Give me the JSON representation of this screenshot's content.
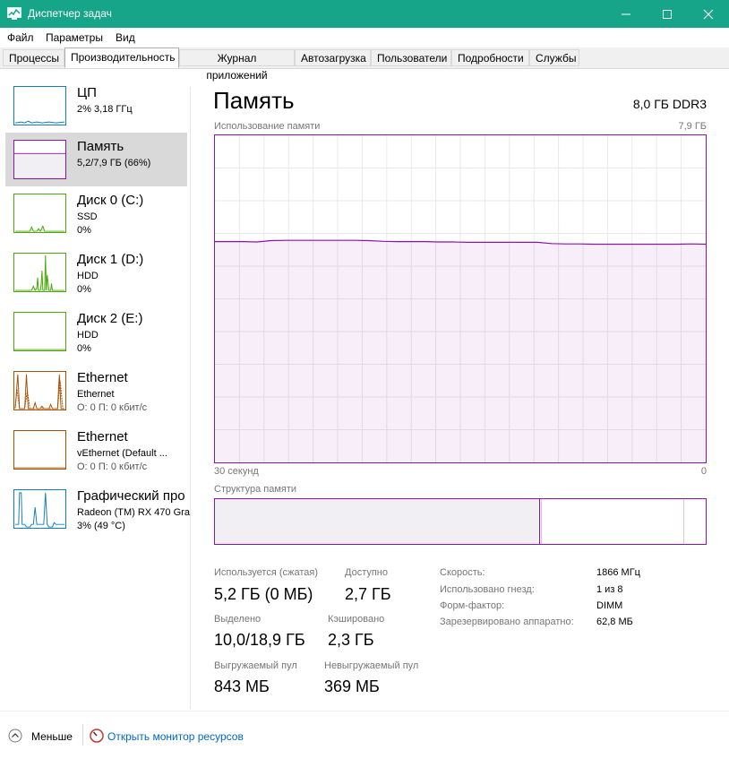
{
  "window": {
    "title": "Диспетчер задач",
    "accent": "#17a589"
  },
  "menu": [
    "Файл",
    "Параметры",
    "Вид"
  ],
  "tabs": [
    "Процессы",
    "Производительность",
    "Журнал приложений",
    "Автозагрузка",
    "Пользователи",
    "Подробности",
    "Службы"
  ],
  "active_tab": "Производительность",
  "sidebar": {
    "items": [
      {
        "name": "ЦП",
        "line1": "2% 3,18 ГГц",
        "line2": "",
        "color": "#117dbb"
      },
      {
        "name": "Память",
        "line1": "5,2/7,9 ГБ (66%)",
        "line2": "",
        "color": "#8b12ae"
      },
      {
        "name": "Диск 0 (C:)",
        "line1": "SSD",
        "line2": "0%",
        "color": "#4da60c"
      },
      {
        "name": "Диск 1 (D:)",
        "line1": "HDD",
        "line2": "0%",
        "color": "#4da60c"
      },
      {
        "name": "Диск 2 (E:)",
        "line1": "HDD",
        "line2": "0%",
        "color": "#4da60c"
      },
      {
        "name": "Ethernet",
        "line1": "Ethernet",
        "line2": "О: 0 П: 0 кбит/с",
        "color": "#a74f01"
      },
      {
        "name": "Ethernet",
        "line1": "vEthernet (Default ...",
        "line2": "О: 0 П: 0 кбит/с",
        "color": "#a74f01"
      },
      {
        "name": "Графический про",
        "line1": "Radeon (TM) RX 470 Gra",
        "line2": "3% (49 °C)",
        "color": "#117dbb"
      }
    ]
  },
  "main": {
    "title": "Память",
    "capacity": "8,0 ГБ DDR3",
    "graph_label": "Использование памяти",
    "graph_max": "7,9 ГБ",
    "graph_time": "30 секунд",
    "graph_min": "0",
    "structure_label": "Структура памяти",
    "usage_series_percent": [
      67.5,
      67.5,
      67.5,
      67.4,
      67.8,
      67.9,
      67.9,
      67.9,
      67.9,
      67.9,
      67.9,
      67.8,
      67.6,
      67.5,
      67.5,
      67.5,
      67.4,
      67.4,
      67.3,
      67.3,
      67.3,
      67.3,
      67.3,
      67.3,
      66.9,
      66.8,
      66.8,
      66.7,
      66.7,
      66.7,
      66.7,
      66.7,
      66.7,
      66.7,
      66.8,
      66.7
    ]
  },
  "stats": {
    "in_use_label": "Используется (сжатая)",
    "in_use_value": "5,2 ГБ (0 МБ)",
    "available_label": "Доступно",
    "available_value": "2,7 ГБ",
    "committed_label": "Выделено",
    "committed_value": "10,0/18,9 ГБ",
    "cached_label": "Кэшировано",
    "cached_value": "2,3 ГБ",
    "paged_label": "Выгружаемый пул",
    "paged_value": "843 МБ",
    "nonpaged_label": "Невыгружаемый пул",
    "nonpaged_value": "369 МБ"
  },
  "details": [
    {
      "label": "Скорость:",
      "value": "1866 МГц"
    },
    {
      "label": "Использовано гнезд:",
      "value": "1 из 8"
    },
    {
      "label": "Форм-фактор:",
      "value": "DIMM"
    },
    {
      "label": "Зарезервировано аппаратно:",
      "value": "62,8 МБ"
    }
  ],
  "footer": {
    "less": "Меньше",
    "monitor": "Открыть монитор ресурсов"
  }
}
